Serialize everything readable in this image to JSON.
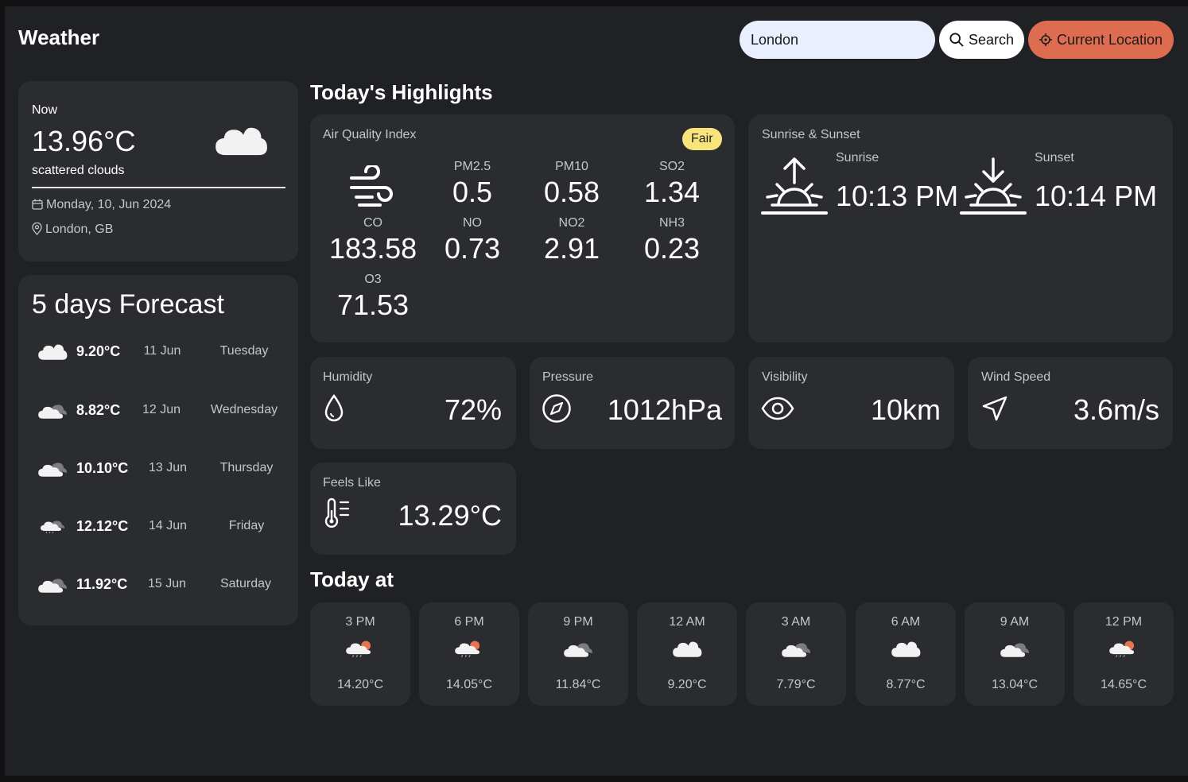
{
  "header": {
    "brand": "Weather",
    "search": {
      "value": "London",
      "button_label": "Search"
    },
    "location_button_label": "Current Location"
  },
  "current": {
    "heading": "Now",
    "temp": "13.96°C",
    "description": "scattered clouds",
    "date": "Monday, 10, Jun 2024",
    "location": "London, GB",
    "icon": "cloud-icon"
  },
  "forecast": {
    "title": "5 days Forecast",
    "days": [
      {
        "temp": "9.20°C",
        "date": "11 Jun",
        "weekday": "Tuesday",
        "icon": "cloud-icon"
      },
      {
        "temp": "8.82°C",
        "date": "12 Jun",
        "weekday": "Wednesday",
        "icon": "overcast-icon"
      },
      {
        "temp": "10.10°C",
        "date": "13 Jun",
        "weekday": "Thursday",
        "icon": "overcast-icon"
      },
      {
        "temp": "12.12°C",
        "date": "14 Jun",
        "weekday": "Friday",
        "icon": "rain-cloud-icon"
      },
      {
        "temp": "11.92°C",
        "date": "15 Jun",
        "weekday": "Saturday",
        "icon": "overcast-icon"
      }
    ]
  },
  "highlights": {
    "title": "Today's Highlights",
    "aqi": {
      "label": "Air Quality Index",
      "badge": "Fair",
      "badge_color": "#f7e57c",
      "items": [
        {
          "name": "PM2.5",
          "value": "0.5"
        },
        {
          "name": "PM10",
          "value": "0.58"
        },
        {
          "name": "SO2",
          "value": "1.34"
        },
        {
          "name": "CO",
          "value": "183.58"
        },
        {
          "name": "NO",
          "value": "0.73"
        },
        {
          "name": "NO2",
          "value": "2.91"
        },
        {
          "name": "NH3",
          "value": "0.23"
        },
        {
          "name": "O3",
          "value": "71.53"
        }
      ]
    },
    "sun": {
      "label": "Sunrise & Sunset",
      "sunrise_label": "Sunrise",
      "sunrise": "10:13 PM",
      "sunset_label": "Sunset",
      "sunset": "10:14 PM"
    },
    "humidity": {
      "label": "Humidity",
      "value": "72%"
    },
    "pressure": {
      "label": "Pressure",
      "value": "1012hPa"
    },
    "visibility": {
      "label": "Visibility",
      "value": "10km"
    },
    "wind": {
      "label": "Wind Speed",
      "value": "3.6m/s"
    },
    "feels_like": {
      "label": "Feels Like",
      "value": "13.29°C"
    }
  },
  "today": {
    "title": "Today at",
    "hours": [
      {
        "time": "3 PM",
        "temp": "14.20°C",
        "icon": "sun-rain-cloud-icon"
      },
      {
        "time": "6 PM",
        "temp": "14.05°C",
        "icon": "sun-rain-cloud-icon"
      },
      {
        "time": "9 PM",
        "temp": "11.84°C",
        "icon": "overcast-icon"
      },
      {
        "time": "12 AM",
        "temp": "9.20°C",
        "icon": "cloud-icon"
      },
      {
        "time": "3 AM",
        "temp": "7.79°C",
        "icon": "overcast-icon"
      },
      {
        "time": "6 AM",
        "temp": "8.77°C",
        "icon": "cloud-icon"
      },
      {
        "time": "9 AM",
        "temp": "13.04°C",
        "icon": "overcast-icon"
      },
      {
        "time": "12 PM",
        "temp": "14.65°C",
        "icon": "sun-rain-cloud-icon"
      }
    ]
  },
  "colors": {
    "background": "#202124",
    "card": "#2b2c30",
    "accent": "#dd6c50",
    "search_bg": "#e9efff"
  }
}
